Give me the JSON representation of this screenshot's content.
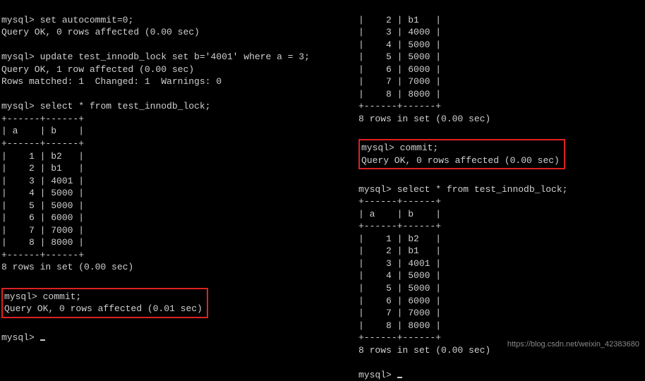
{
  "prompt": "mysql>",
  "left": {
    "cmd1": "set autocommit=0;",
    "res1": "Query OK, 0 rows affected (0.00 sec)",
    "cmd2": "update test_innodb_lock set b='4001' where a = 3;",
    "res2a": "Query OK, 1 row affected (0.00 sec)",
    "res2b": "Rows matched: 1  Changed: 1  Warnings: 0",
    "cmd3": "select * from test_innodb_lock;",
    "tbl_sep": "+------+------+",
    "hdr_a": "a",
    "hdr_b": "b",
    "rows": [
      {
        "a": "1",
        "b": "b2"
      },
      {
        "a": "2",
        "b": "b1"
      },
      {
        "a": "3",
        "b": "4001"
      },
      {
        "a": "4",
        "b": "5000"
      },
      {
        "a": "5",
        "b": "5000"
      },
      {
        "a": "6",
        "b": "6000"
      },
      {
        "a": "7",
        "b": "7000"
      },
      {
        "a": "8",
        "b": "8000"
      }
    ],
    "rowcount": "8 rows in set (0.00 sec)",
    "cmd4": "commit;",
    "res4": "Query OK, 0 rows affected (0.01 sec)"
  },
  "right": {
    "top_rows": [
      {
        "a": "2",
        "b": "b1"
      },
      {
        "a": "3",
        "b": "4000"
      },
      {
        "a": "4",
        "b": "5000"
      },
      {
        "a": "5",
        "b": "5000"
      },
      {
        "a": "6",
        "b": "6000"
      },
      {
        "a": "7",
        "b": "7000"
      },
      {
        "a": "8",
        "b": "8000"
      }
    ],
    "tbl_sep": "+------+------+",
    "rowcount1": "8 rows in set (0.00 sec)",
    "cmd1": "commit;",
    "res1": "Query OK, 0 rows affected (0.00 sec)",
    "cmd2": "select * from test_innodb_lock;",
    "hdr_a": "a",
    "hdr_b": "b",
    "rows2": [
      {
        "a": "1",
        "b": "b2"
      },
      {
        "a": "2",
        "b": "b1"
      },
      {
        "a": "3",
        "b": "4001"
      },
      {
        "a": "4",
        "b": "5000"
      },
      {
        "a": "5",
        "b": "5000"
      },
      {
        "a": "6",
        "b": "6000"
      },
      {
        "a": "7",
        "b": "7000"
      },
      {
        "a": "8",
        "b": "8000"
      }
    ],
    "rowcount2": "8 rows in set (0.00 sec)"
  },
  "watermark": "https://blog.csdn.net/weixin_42383680"
}
